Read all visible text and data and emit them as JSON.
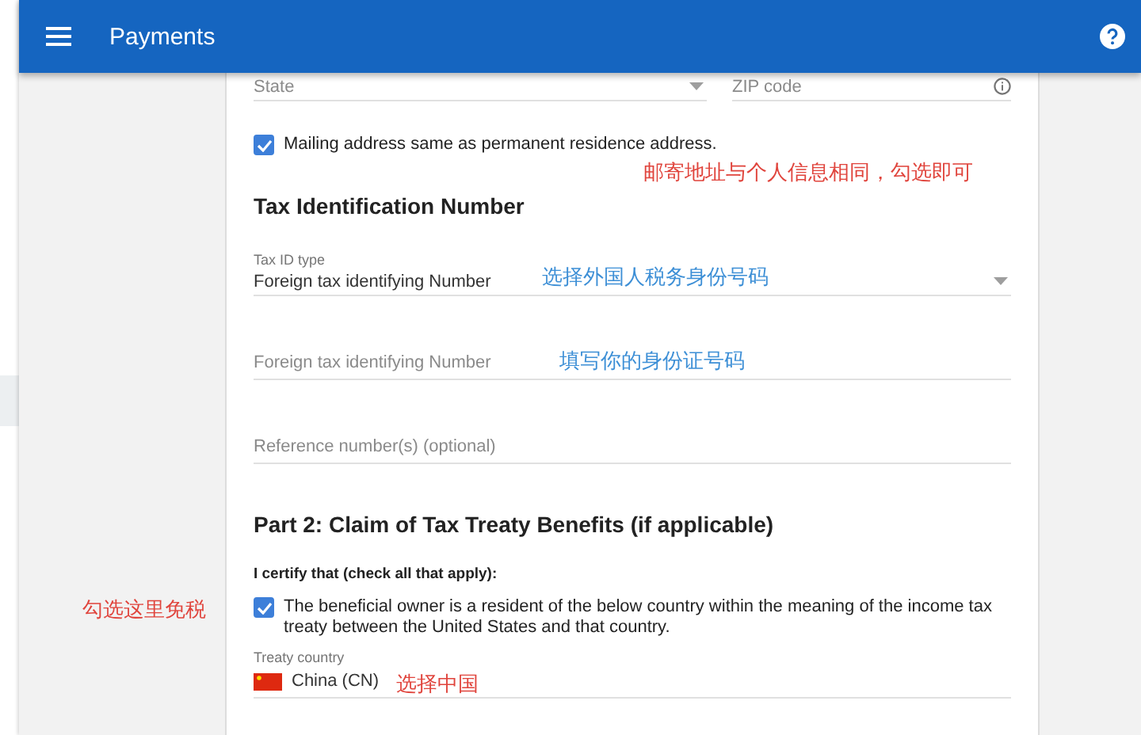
{
  "app_bar": {
    "title": "Payments"
  },
  "address": {
    "state": {
      "placeholder": "State"
    },
    "zip": {
      "placeholder": "ZIP code"
    }
  },
  "mailing_same": {
    "label": "Mailing address same as permanent residence address.",
    "checked": true,
    "note": {
      "text": "邮寄地址与个人信息相同，勾选即可",
      "color": "#e0443c"
    }
  },
  "tax_id": {
    "heading": "Tax Identification Number",
    "type_field": {
      "label": "Tax ID type",
      "value": "Foreign tax identifying Number",
      "note": {
        "text": "选择外国人税务身份号码",
        "color": "#3d8fd6"
      }
    },
    "number_field": {
      "placeholder": "Foreign tax identifying Number",
      "note": {
        "text": "填写你的身份证号码",
        "color": "#3d8fd6"
      }
    },
    "reference_field": {
      "placeholder": "Reference number(s) (optional)"
    }
  },
  "part2": {
    "heading": "Part 2: Claim of Tax Treaty Benefits (if applicable)",
    "certify_label": "I certify that (check all that apply):",
    "claims": [
      {
        "label": "The beneficial owner is a resident of the below country within the meaning of the income tax treaty between the United States and that country.",
        "checked": true,
        "note": {
          "text": "勾选这里免税",
          "color": "#e0443c"
        }
      }
    ],
    "treaty_country": {
      "label": "Treaty country",
      "value": "China (CN)",
      "note": {
        "text": "选择中国",
        "color": "#e0443c"
      }
    }
  }
}
